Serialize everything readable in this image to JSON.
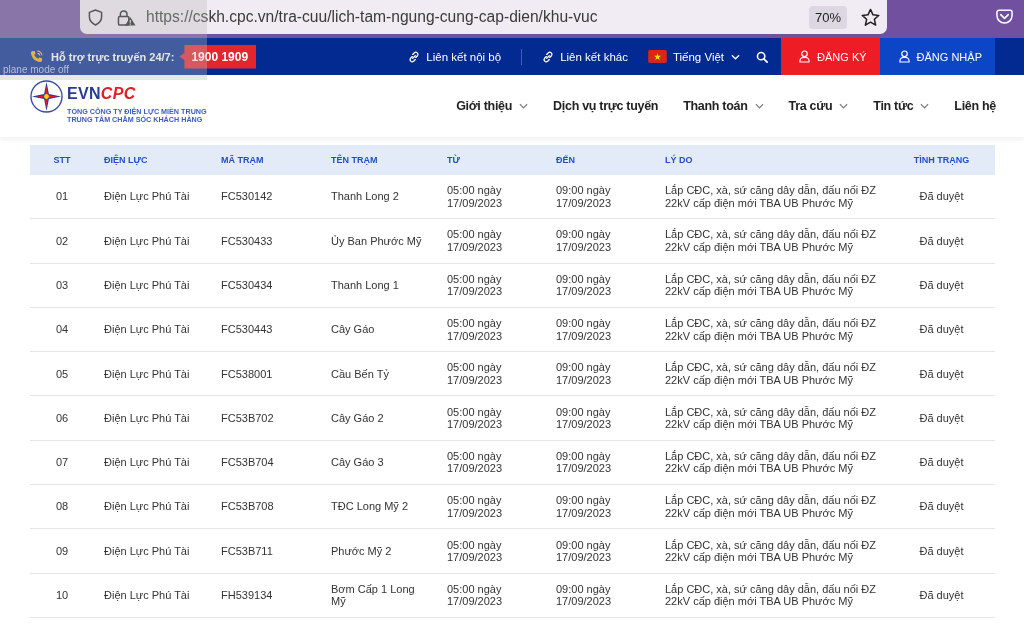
{
  "browser": {
    "url": "https://cskh.cpc.vn/tra-cuu/lich-tam-ngung-cung-cap-dien/khu-vuc",
    "zoom": "70%"
  },
  "notification": {
    "text": "plane mode off"
  },
  "top_bar": {
    "support_label": "Hỗ trợ trực truyến 24/7:",
    "hotline": "1900 1909",
    "links": [
      "Liên kết nội bộ",
      "Liên kết khác"
    ],
    "language": "Tiếng Việt",
    "buttons": [
      {
        "label": "ĐĂNG KÝ",
        "kind": "register"
      },
      {
        "label": "ĐĂNG NHẬP",
        "kind": "login"
      }
    ]
  },
  "header": {
    "logo": {
      "brand": "EVN",
      "brand_accent": "CPC",
      "lines": [
        "TỔNG CÔNG TY ĐIỆN LỰC MIỀN TRUNG",
        "TRUNG TÂM CHĂM SÓC KHÁCH HÀNG"
      ]
    },
    "nav": [
      {
        "label": "Giới thiệu",
        "has_menu": true
      },
      {
        "label": "Dịch vụ trực tuyến",
        "has_menu": false
      },
      {
        "label": "Thanh toán",
        "has_menu": true
      },
      {
        "label": "Tra cứu",
        "has_menu": true
      },
      {
        "label": "Tin tức",
        "has_menu": true
      },
      {
        "label": "Liên hệ",
        "has_menu": false
      }
    ]
  },
  "table": {
    "columns": [
      "STT",
      "ĐIỆN LỰC",
      "MÃ TRẠM",
      "TÊN TRẠM",
      "TỪ",
      "ĐẾN",
      "LÝ DO",
      "TÌNH TRẠNG"
    ],
    "rows": [
      [
        "01",
        "Điện Lực Phú Tài",
        "FC530142",
        "Thanh Long 2",
        "05:00 ngày 17/09/2023",
        "09:00 ngày 17/09/2023",
        "Lắp CĐC, xà, sứ căng dây dẫn, đấu nối ĐZ 22kV cấp điện mới TBA UB Phước Mỹ",
        "Đã duyệt"
      ],
      [
        "02",
        "Điện Lực Phú Tài",
        "FC530433",
        "Ủy Ban Phước Mỹ",
        "05:00 ngày 17/09/2023",
        "09:00 ngày 17/09/2023",
        "Lắp CĐC, xà, sứ căng dây dẫn, đấu nối ĐZ 22kV cấp điện mới TBA UB Phước Mỹ",
        "Đã duyệt"
      ],
      [
        "03",
        "Điện Lực Phú Tài",
        "FC530434",
        "Thanh Long 1",
        "05:00 ngày 17/09/2023",
        "09:00 ngày 17/09/2023",
        "Lắp CĐC, xà, sứ căng dây dẫn, đấu nối ĐZ 22kV cấp điện mới TBA UB Phước Mỹ",
        "Đã duyệt"
      ],
      [
        "04",
        "Điện Lực Phú Tài",
        "FC530443",
        "Cây Gáo",
        "05:00 ngày 17/09/2023",
        "09:00 ngày 17/09/2023",
        "Lắp CĐC, xà, sứ căng dây dẫn, đấu nối ĐZ 22kV cấp điện mới TBA UB Phước Mỹ",
        "Đã duyệt"
      ],
      [
        "05",
        "Điện Lực Phú Tài",
        "FC538001",
        "Cầu Bến Tỷ",
        "05:00 ngày 17/09/2023",
        "09:00 ngày 17/09/2023",
        "Lắp CĐC, xà, sứ căng dây dẫn, đấu nối ĐZ 22kV cấp điện mới TBA UB Phước Mỹ",
        "Đã duyệt"
      ],
      [
        "06",
        "Điện Lực Phú Tài",
        "FC53B702",
        "Cây Gáo 2",
        "05:00 ngày 17/09/2023",
        "09:00 ngày 17/09/2023",
        "Lắp CĐC, xà, sứ căng dây dẫn, đấu nối ĐZ 22kV cấp điện mới TBA UB Phước Mỹ",
        "Đã duyệt"
      ],
      [
        "07",
        "Điện Lực Phú Tài",
        "FC53B704",
        "Cây Gáo 3",
        "05:00 ngày 17/09/2023",
        "09:00 ngày 17/09/2023",
        "Lắp CĐC, xà, sứ căng dây dẫn, đấu nối ĐZ 22kV cấp điện mới TBA UB Phước Mỹ",
        "Đã duyệt"
      ],
      [
        "08",
        "Điện Lực Phú Tài",
        "FC53B708",
        "TĐC Long Mỹ 2",
        "05:00 ngày 17/09/2023",
        "09:00 ngày 17/09/2023",
        "Lắp CĐC, xà, sứ căng dây dẫn, đấu nối ĐZ 22kV cấp điện mới TBA UB Phước Mỹ",
        "Đã duyệt"
      ],
      [
        "09",
        "Điện Lực Phú Tài",
        "FC53B711",
        "Phước Mỹ 2",
        "05:00 ngày 17/09/2023",
        "09:00 ngày 17/09/2023",
        "Lắp CĐC, xà, sứ căng dây dẫn, đấu nối ĐZ 22kV cấp điện mới TBA UB Phước Mỹ",
        "Đã duyệt"
      ],
      [
        "10",
        "Điện Lực Phú Tài",
        "FH539134",
        "Bơm Cấp 1 Long Mỹ",
        "05:00 ngày 17/09/2023",
        "09:00 ngày 17/09/2023",
        "Lắp CĐC, xà, sứ căng dây dẫn, đấu nối ĐZ 22kV cấp điện mới TBA UB Phước Mỹ",
        "Đã duyệt"
      ]
    ]
  }
}
